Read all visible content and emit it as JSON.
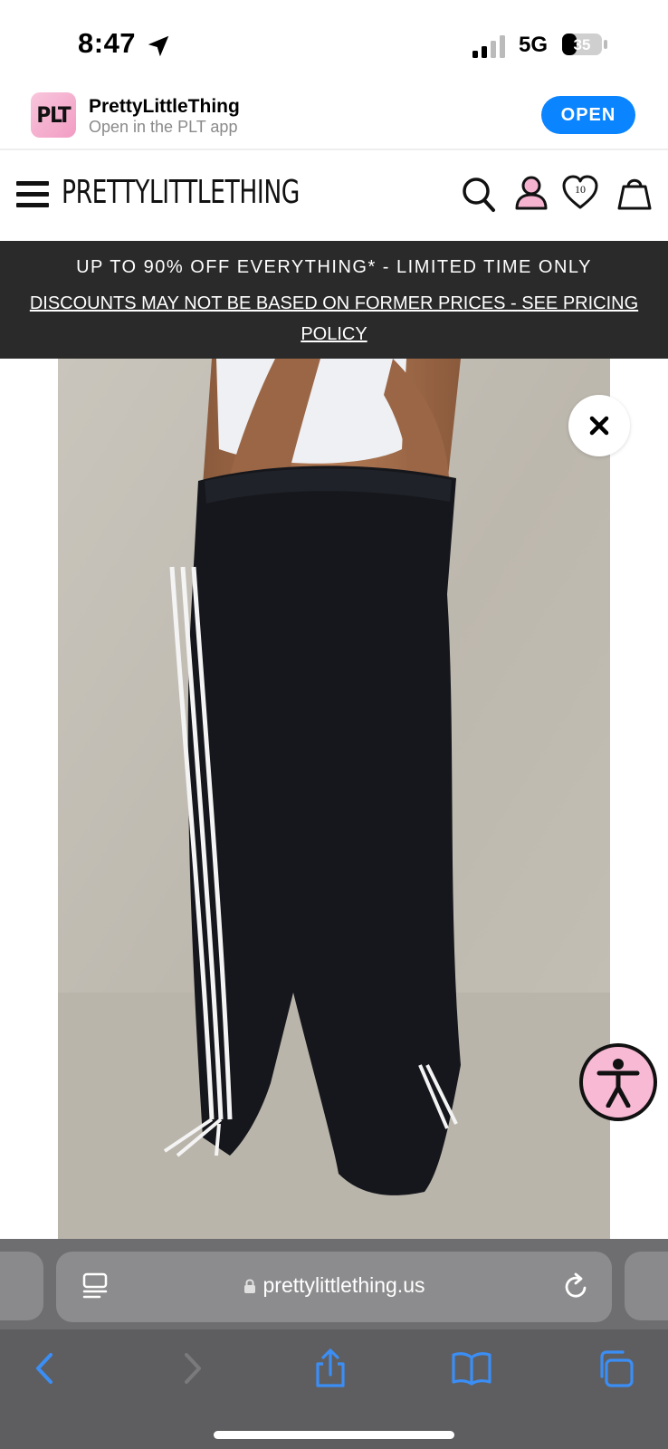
{
  "status_bar": {
    "time": "8:47",
    "network": "5G",
    "battery": "35"
  },
  "app_banner": {
    "icon_text": "PLT",
    "name": "PrettyLittleThing",
    "subtitle": "Open in the PLT app",
    "open_label": "OPEN"
  },
  "header": {
    "brand": "PRETTYLITTLETHING",
    "wishlist_count": "10"
  },
  "promo": {
    "line1": "UP TO 90% OFF EVERYTHING* - LIMITED TIME ONLY",
    "line2": "DISCOUNTS MAY NOT BE BASED ON FORMER PRICES - SEE PRICING POLICY"
  },
  "browser": {
    "url": "prettylittlething.us"
  },
  "colors": {
    "accent_blue": "#0a84ff",
    "promo_bg": "#2a2a2a",
    "pink": "#f8b9d4",
    "toolbar": "#5e5e60"
  }
}
